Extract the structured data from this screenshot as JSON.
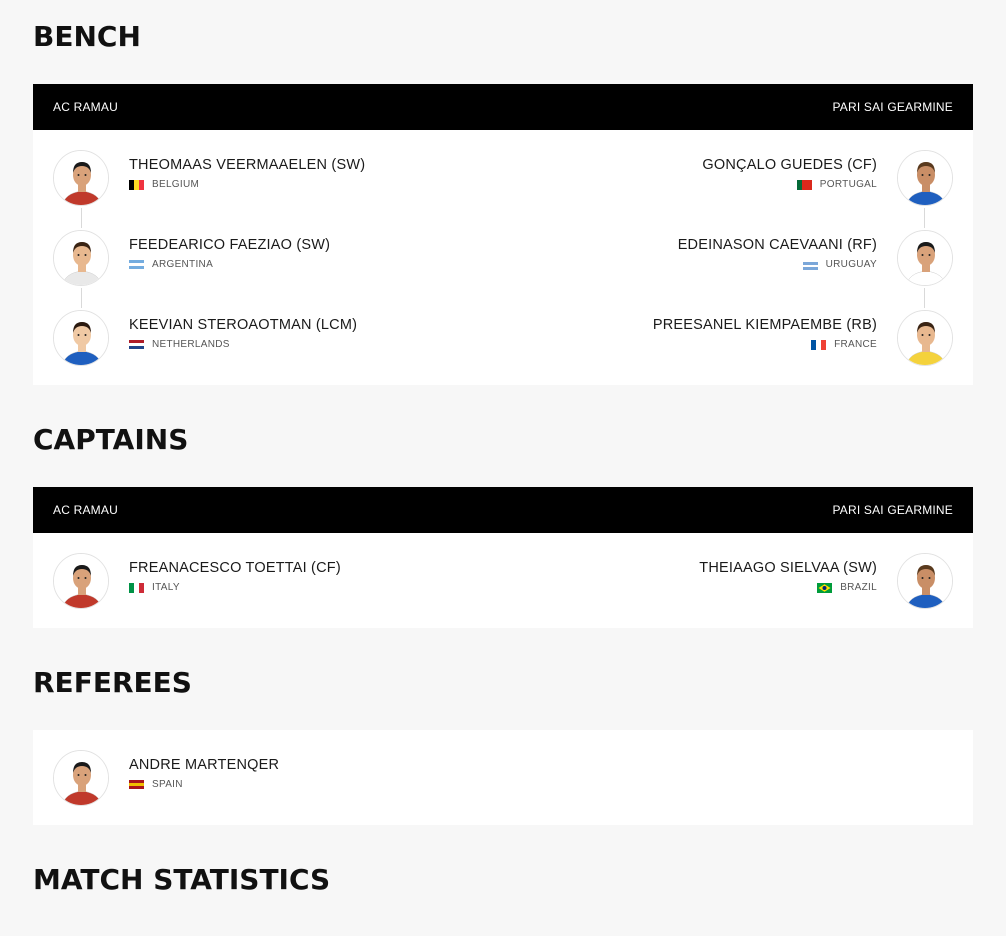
{
  "sections": {
    "bench": "BENCH",
    "captains": "CAPTAINS",
    "referees": "REFEREES",
    "match_statistics": "MATCH STATISTICS"
  },
  "teams": {
    "home": "AC RAMAU",
    "away": "PARI SAI GEARMINE"
  },
  "bench": {
    "home": [
      {
        "name": "THEOMAAS VEERMAAELEN (SW)",
        "country": "BELGIUM",
        "flag": [
          "#000000",
          "#FDDA24",
          "#EF3340"
        ],
        "flag_dir": "vertical"
      },
      {
        "name": "FEEDEARICO FAEZIAO (SW)",
        "country": "ARGENTINA",
        "flag": [
          "#74ACDF",
          "#FFFFFF",
          "#74ACDF"
        ],
        "flag_dir": "horizontal"
      },
      {
        "name": "KEEVIAN STEROAOTMAN (LCM)",
        "country": "NETHERLANDS",
        "flag": [
          "#AE1C28",
          "#FFFFFF",
          "#21468B"
        ],
        "flag_dir": "horizontal"
      }
    ],
    "away": [
      {
        "name": "GONÇALO GUEDES (CF)",
        "country": "PORTUGAL",
        "flag": [
          "#046A38",
          "#DA291C",
          "#DA291C"
        ],
        "flag_dir": "vertical"
      },
      {
        "name": "EDEINASON CAEVAANI (RF)",
        "country": "URUGUAY",
        "flag": [
          "#FFFFFF",
          "#7BA7D9",
          "#FFFFFF",
          "#7BA7D9"
        ],
        "flag_dir": "horizontal"
      },
      {
        "name": "PREESANEL KIEMPAEMBE (RB)",
        "country": "FRANCE",
        "flag": [
          "#0055A4",
          "#FFFFFF",
          "#EF4135"
        ],
        "flag_dir": "vertical"
      }
    ]
  },
  "captains": {
    "home": [
      {
        "name": "FREANACESCO TOETTAI (CF)",
        "country": "ITALY",
        "flag": [
          "#009246",
          "#FFFFFF",
          "#CE2B37"
        ],
        "flag_dir": "vertical"
      }
    ],
    "away": [
      {
        "name": "THEIAAGO SIELVAA (SW)",
        "country": "BRAZIL",
        "flag": [
          "#009C3B",
          "#FFDF00",
          "#009C3B"
        ],
        "flag_dir": "brazil"
      }
    ]
  },
  "referees": [
    {
      "name": "ANDRE MARTENQER",
      "country": "SPAIN",
      "flag": [
        "#AA151B",
        "#F1BF00",
        "#AA151B"
      ],
      "flag_dir": "horizontal"
    }
  ]
}
